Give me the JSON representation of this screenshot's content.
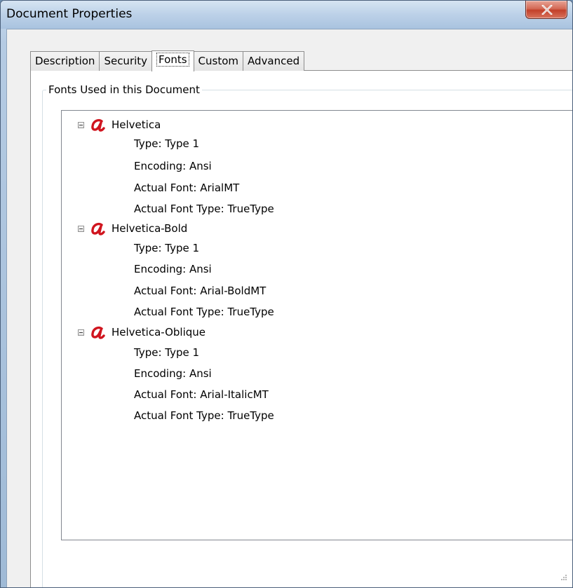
{
  "window": {
    "title": "Document Properties",
    "close_label": "X"
  },
  "tabs": [
    {
      "label": "Description",
      "active": false
    },
    {
      "label": "Security",
      "active": false
    },
    {
      "label": "Fonts",
      "active": true
    },
    {
      "label": "Custom",
      "active": false
    },
    {
      "label": "Advanced",
      "active": false
    }
  ],
  "group": {
    "label": "Fonts Used in this Document"
  },
  "fonts": [
    {
      "name": "Helvetica",
      "details": [
        "Type: Type 1",
        "Encoding: Ansi",
        "Actual Font: ArialMT",
        "Actual Font Type: TrueType"
      ]
    },
    {
      "name": "Helvetica-Bold",
      "details": [
        "Type: Type 1",
        "Encoding: Ansi",
        "Actual Font: Arial-BoldMT",
        "Actual Font Type: TrueType"
      ]
    },
    {
      "name": "Helvetica-Oblique",
      "details": [
        "Type: Type 1",
        "Encoding: Ansi",
        "Actual Font: Arial-ItalicMT",
        "Actual Font Type: TrueType"
      ]
    }
  ],
  "colors": {
    "font_icon": "#d0141e",
    "close_button": "#c2412b",
    "titlebar": "#bcd1e8"
  }
}
